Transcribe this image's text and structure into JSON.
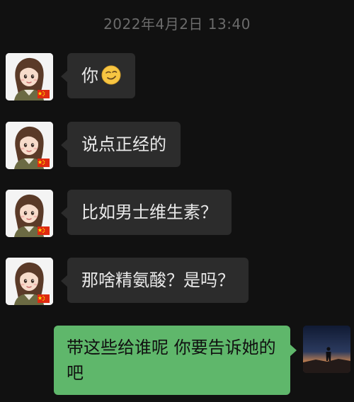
{
  "chat": {
    "timestamp": "2022年4月2日 13:40",
    "messages": [
      {
        "sender": "them",
        "text": "你",
        "emoji": "smirk-face-icon"
      },
      {
        "sender": "them",
        "text": "说点正经的"
      },
      {
        "sender": "them",
        "text": "比如男士维生素？"
      },
      {
        "sender": "them",
        "text": "那啥精氨酸？是吗？"
      },
      {
        "sender": "me",
        "text": "带这些给谁呢 你要告诉她的吧"
      }
    ]
  },
  "colors": {
    "background": "#111111",
    "incoming_bubble": "#2c2c2c",
    "outgoing_bubble": "#5fb76b",
    "timestamp": "#6b6b6b"
  }
}
